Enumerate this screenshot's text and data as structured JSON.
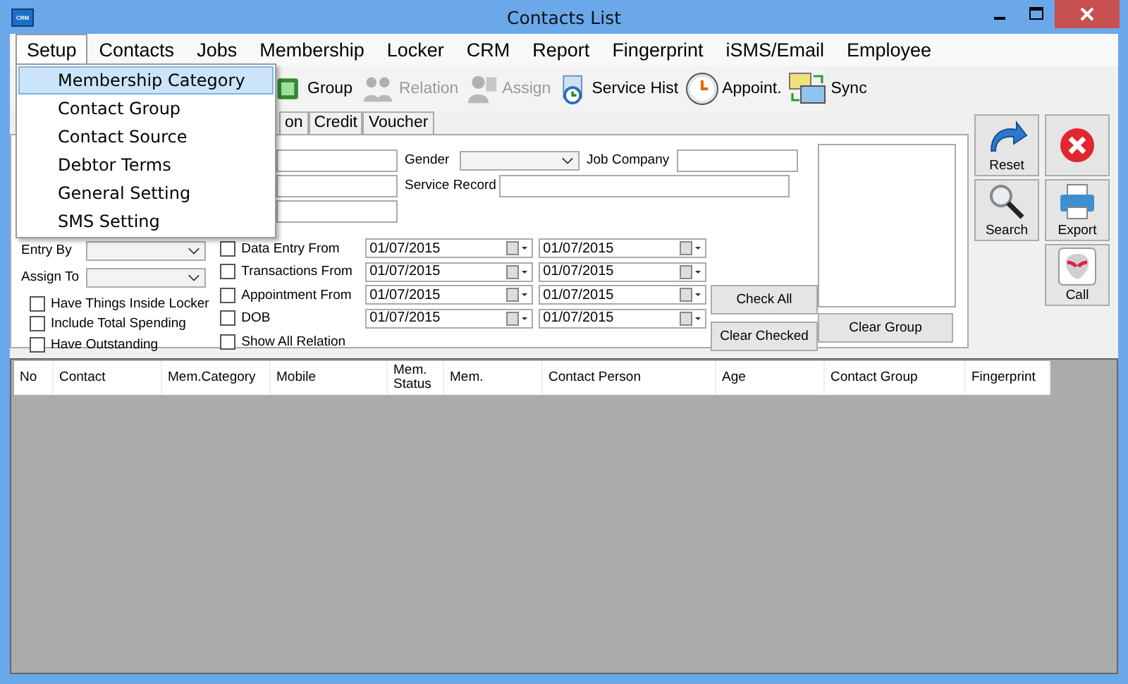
{
  "window": {
    "title": "Contacts List",
    "icon_label": "CRM"
  },
  "menu": [
    {
      "label": "Setup",
      "selected": true
    },
    {
      "label": "Contacts",
      "selected": false
    },
    {
      "label": "Jobs",
      "selected": false
    },
    {
      "label": "Membership",
      "selected": false
    },
    {
      "label": "Locker",
      "selected": false
    },
    {
      "label": "CRM",
      "selected": false
    },
    {
      "label": "Report",
      "selected": false
    },
    {
      "label": "Fingerprint",
      "selected": false
    },
    {
      "label": "iSMS/Email",
      "selected": false
    },
    {
      "label": "Employee",
      "selected": false
    }
  ],
  "setup_menu": [
    {
      "label": "Membership Category",
      "selected": true
    },
    {
      "label": "Contact Group",
      "selected": false
    },
    {
      "label": "Contact Source",
      "selected": false
    },
    {
      "label": "Debtor Terms",
      "selected": false
    },
    {
      "label": "General Setting",
      "selected": false
    },
    {
      "label": "SMS Setting",
      "selected": false
    }
  ],
  "toolbar": [
    {
      "label": "Group",
      "kind": "group",
      "disabled": false
    },
    {
      "label": "Relation",
      "kind": "relation",
      "disabled": true
    },
    {
      "label": "Assign",
      "kind": "assign",
      "disabled": true
    },
    {
      "label": "Service Hist",
      "kind": "history",
      "disabled": false
    },
    {
      "label": "Appoint.",
      "kind": "clock",
      "disabled": false
    },
    {
      "label": "Sync",
      "kind": "sync",
      "disabled": false
    }
  ],
  "tabs": [
    {
      "label": "on",
      "selected": false
    },
    {
      "label": "Credit",
      "selected": false
    },
    {
      "label": "Voucher",
      "selected": false
    }
  ],
  "fields": {
    "gender_label": "Gender",
    "job_company_label": "Job Company",
    "service_record_label": "Service Record",
    "entry_by_label": "Entry By",
    "assign_to_label": "Assign To"
  },
  "options": [
    {
      "label": "Have Things Inside Locker",
      "checked": false
    },
    {
      "label": "Include Total Spending",
      "checked": false
    },
    {
      "label": "Have Outstanding",
      "checked": false
    }
  ],
  "date_filters": [
    {
      "label": "Data Entry From",
      "checked": false,
      "from": "01/07/2015",
      "to": "01/07/2015"
    },
    {
      "label": "Transactions From",
      "checked": false,
      "from": "01/07/2015",
      "to": "01/07/2015"
    },
    {
      "label": "Appointment From",
      "checked": false,
      "from": "01/07/2015",
      "to": "01/07/2015"
    },
    {
      "label": "DOB",
      "checked": false,
      "from": "01/07/2015",
      "to": "01/07/2015"
    }
  ],
  "show_all_relation": {
    "label": "Show All Relation",
    "checked": false
  },
  "form_buttons": {
    "check_all": "Check All",
    "clear_checked": "Clear Checked",
    "clear_group": "Clear Group"
  },
  "side_buttons": [
    {
      "label": "Reset",
      "kind": "reset"
    },
    {
      "kind": "close"
    },
    {
      "label": "Search",
      "kind": "search"
    },
    {
      "label": "Export",
      "kind": "export"
    },
    {
      "label": "Call",
      "kind": "call"
    }
  ],
  "table": {
    "columns": [
      "No",
      "Contact",
      "Mem.Category",
      "Mobile",
      "Mem.\nStatus",
      "Mem.",
      "Contact Person",
      "Age",
      "Contact Group",
      "Fingerprint"
    ]
  }
}
